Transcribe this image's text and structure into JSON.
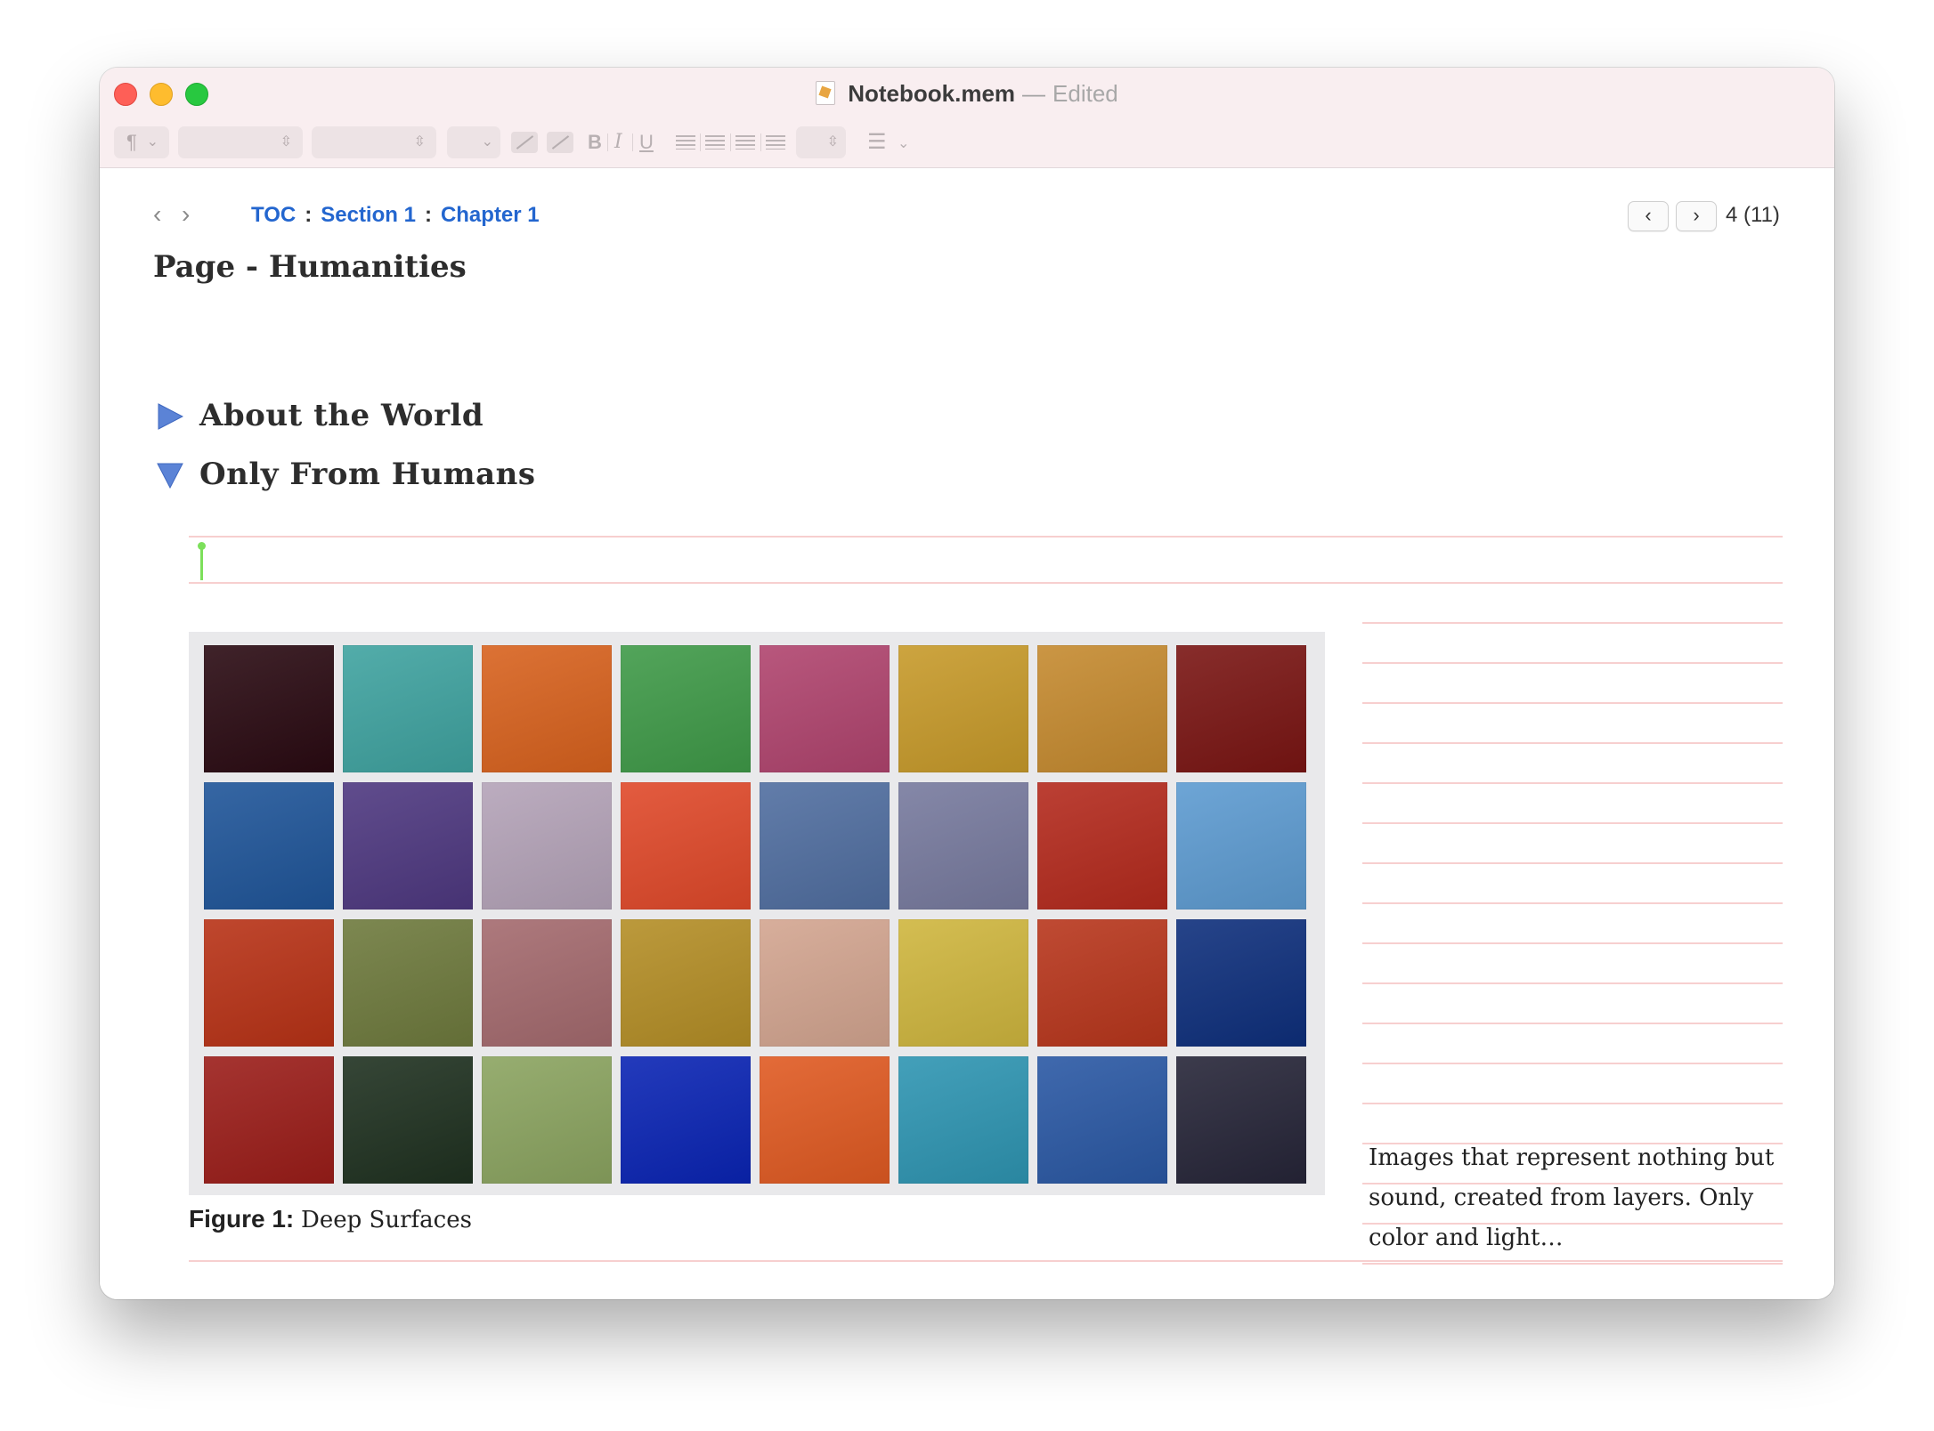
{
  "window": {
    "filename": "Notebook.mem",
    "separator": "—",
    "status": "Edited"
  },
  "toolbar": {
    "paragraph_glyph": "¶",
    "bold": "B",
    "italic": "I",
    "underline": "U",
    "list_glyph": "☰"
  },
  "navigation": {
    "back_arrow": "‹",
    "forward_arrow": "›",
    "breadcrumb": {
      "toc": "TOC",
      "section": "Section 1",
      "chapter": "Chapter 1",
      "separator": ":"
    },
    "pager": {
      "prev": "‹",
      "next": "›",
      "position": "4 (11)"
    }
  },
  "page": {
    "title": "Page -  Humanities"
  },
  "sections": [
    {
      "title": "About the World",
      "expanded": false
    },
    {
      "title": "Only From Humans",
      "expanded": true
    }
  ],
  "figure": {
    "label": "Figure 1:",
    "caption": "Deep Surfaces",
    "tiles": [
      [
        "#2a0a12",
        "#3fa3a0",
        "#d8621e",
        "#3f9a48",
        "#b0446e",
        "#c79a2a",
        "#c58a2f",
        "#7a1513"
      ],
      [
        "#1f5599",
        "#4e3880",
        "#b4a3b8",
        "#e0492a",
        "#506ea0",
        "#777a9e",
        "#b42a1d",
        "#5d9bd1"
      ],
      [
        "#b83216",
        "#6e7a3d",
        "#a46a6e",
        "#b48e26",
        "#d3a590",
        "#cfb63e",
        "#b8361c",
        "#0e2f7c"
      ],
      [
        "#9b1d19",
        "#1f3120",
        "#8ba460",
        "#0a24b4",
        "#e05a22",
        "#2e95b2",
        "#2a58a4",
        "#262538"
      ]
    ]
  },
  "side_note": "Images that represent nothing but sound, created from layers. Only color and light…",
  "colors": {
    "link": "#2366cf",
    "disclosure": "#5b83d6",
    "rule": "#f7cfcf",
    "cursor": "#7ce05b",
    "titlebar": "#f9eef0"
  }
}
